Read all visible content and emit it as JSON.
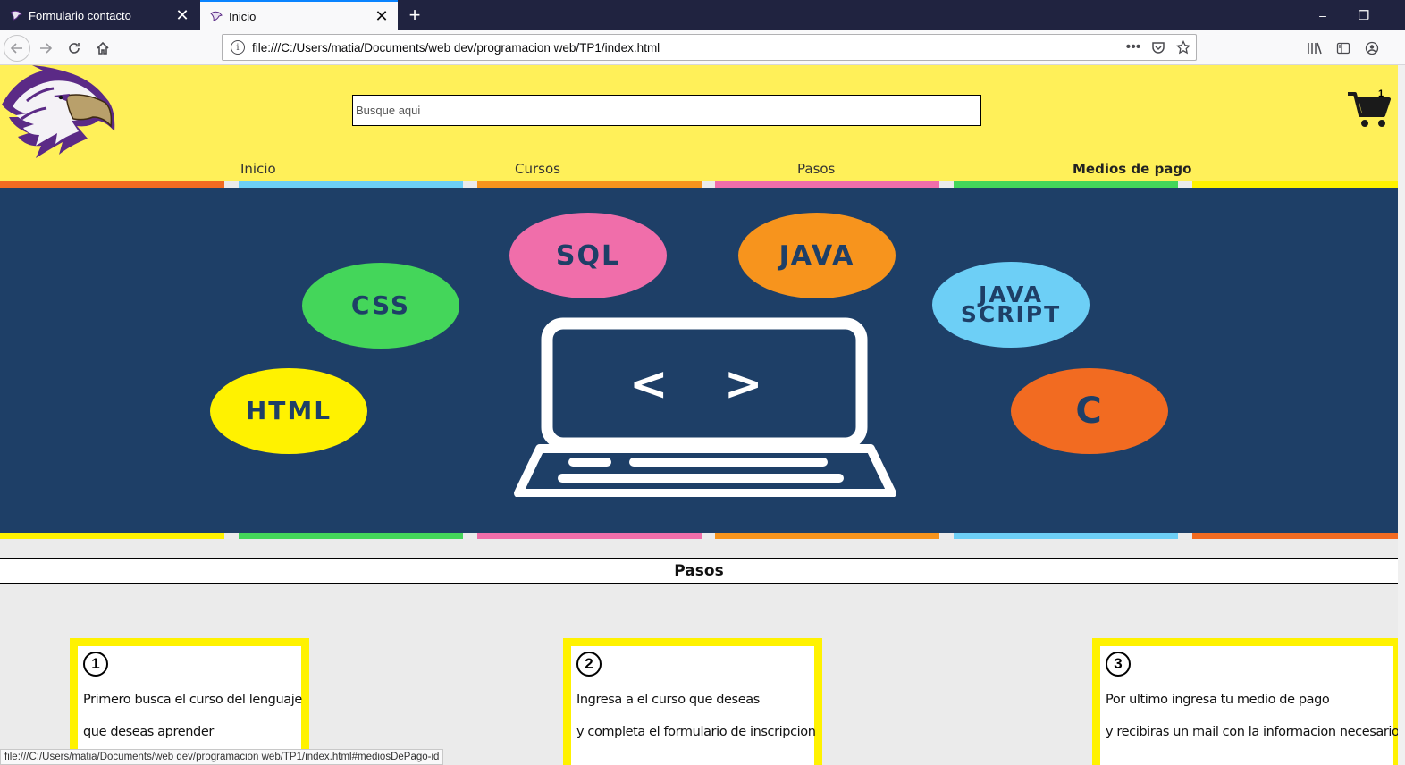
{
  "browser": {
    "tabs": [
      {
        "title": "Formulario contacto",
        "active": false
      },
      {
        "title": "Inicio",
        "active": true
      }
    ],
    "url": "file:///C:/Users/matia/Documents/web dev/programacion web/TP1/index.html",
    "status_url": "file:///C:/Users/matia/Documents/web dev/programacion web/TP1/index.html#mediosDePago-id"
  },
  "header": {
    "search_placeholder": "Busque aqui",
    "cart_count": "1",
    "nav": [
      "Inicio",
      "Cursos",
      "Pasos",
      "Medios de pago"
    ]
  },
  "hero": {
    "bubbles": [
      "SQL",
      "JAVA",
      "CSS",
      "JAVA SCRIPT",
      "HTML",
      "C"
    ],
    "code_glyphs": "<   >"
  },
  "pasos": {
    "title": "Pasos",
    "steps": [
      {
        "number": "1",
        "lines": [
          "Primero busca el curso del lenguaje",
          "que deseas aprender"
        ]
      },
      {
        "number": "2",
        "lines": [
          "Ingresa a el curso que deseas",
          "y completa el formulario de inscripcion"
        ]
      },
      {
        "number": "3",
        "lines": [
          "Por ultimo ingresa tu medio de pago",
          "y recibiras un mail con la informacion necesario"
        ]
      }
    ]
  },
  "colors": {
    "header_bg": "#fff059",
    "hero_bg": "#1e3f67",
    "card_border": "#fff200",
    "orange": "#f26b21",
    "blue": "#6dcff6",
    "amber": "#f7941d",
    "pink": "#f06eaa",
    "green": "#44d65a",
    "yellow": "#fff200"
  }
}
